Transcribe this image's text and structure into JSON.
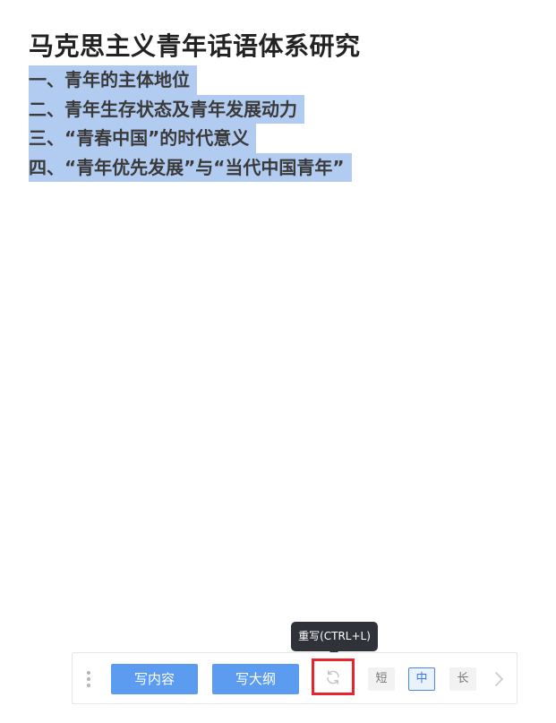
{
  "document": {
    "title": "马克思主义青年话语体系研究",
    "outline": [
      "一、青年的主体地位",
      "二、青年生存状态及青年发展动力",
      "三、“青春中国”的时代意义",
      "四、“青年优先发展”与“当代中国青年”"
    ],
    "selection_color": "#b2cbf0"
  },
  "tooltip": {
    "text": "重写(CTRL+L)"
  },
  "toolbar": {
    "write_content_label": "写内容",
    "write_outline_label": "写大纲",
    "rewrite_icon": "refresh-icon",
    "length_options": [
      "短",
      "中",
      "长"
    ],
    "selected_length": "中",
    "accent_color": "#5b9cf0",
    "highlight_border_color": "#e6262c"
  }
}
